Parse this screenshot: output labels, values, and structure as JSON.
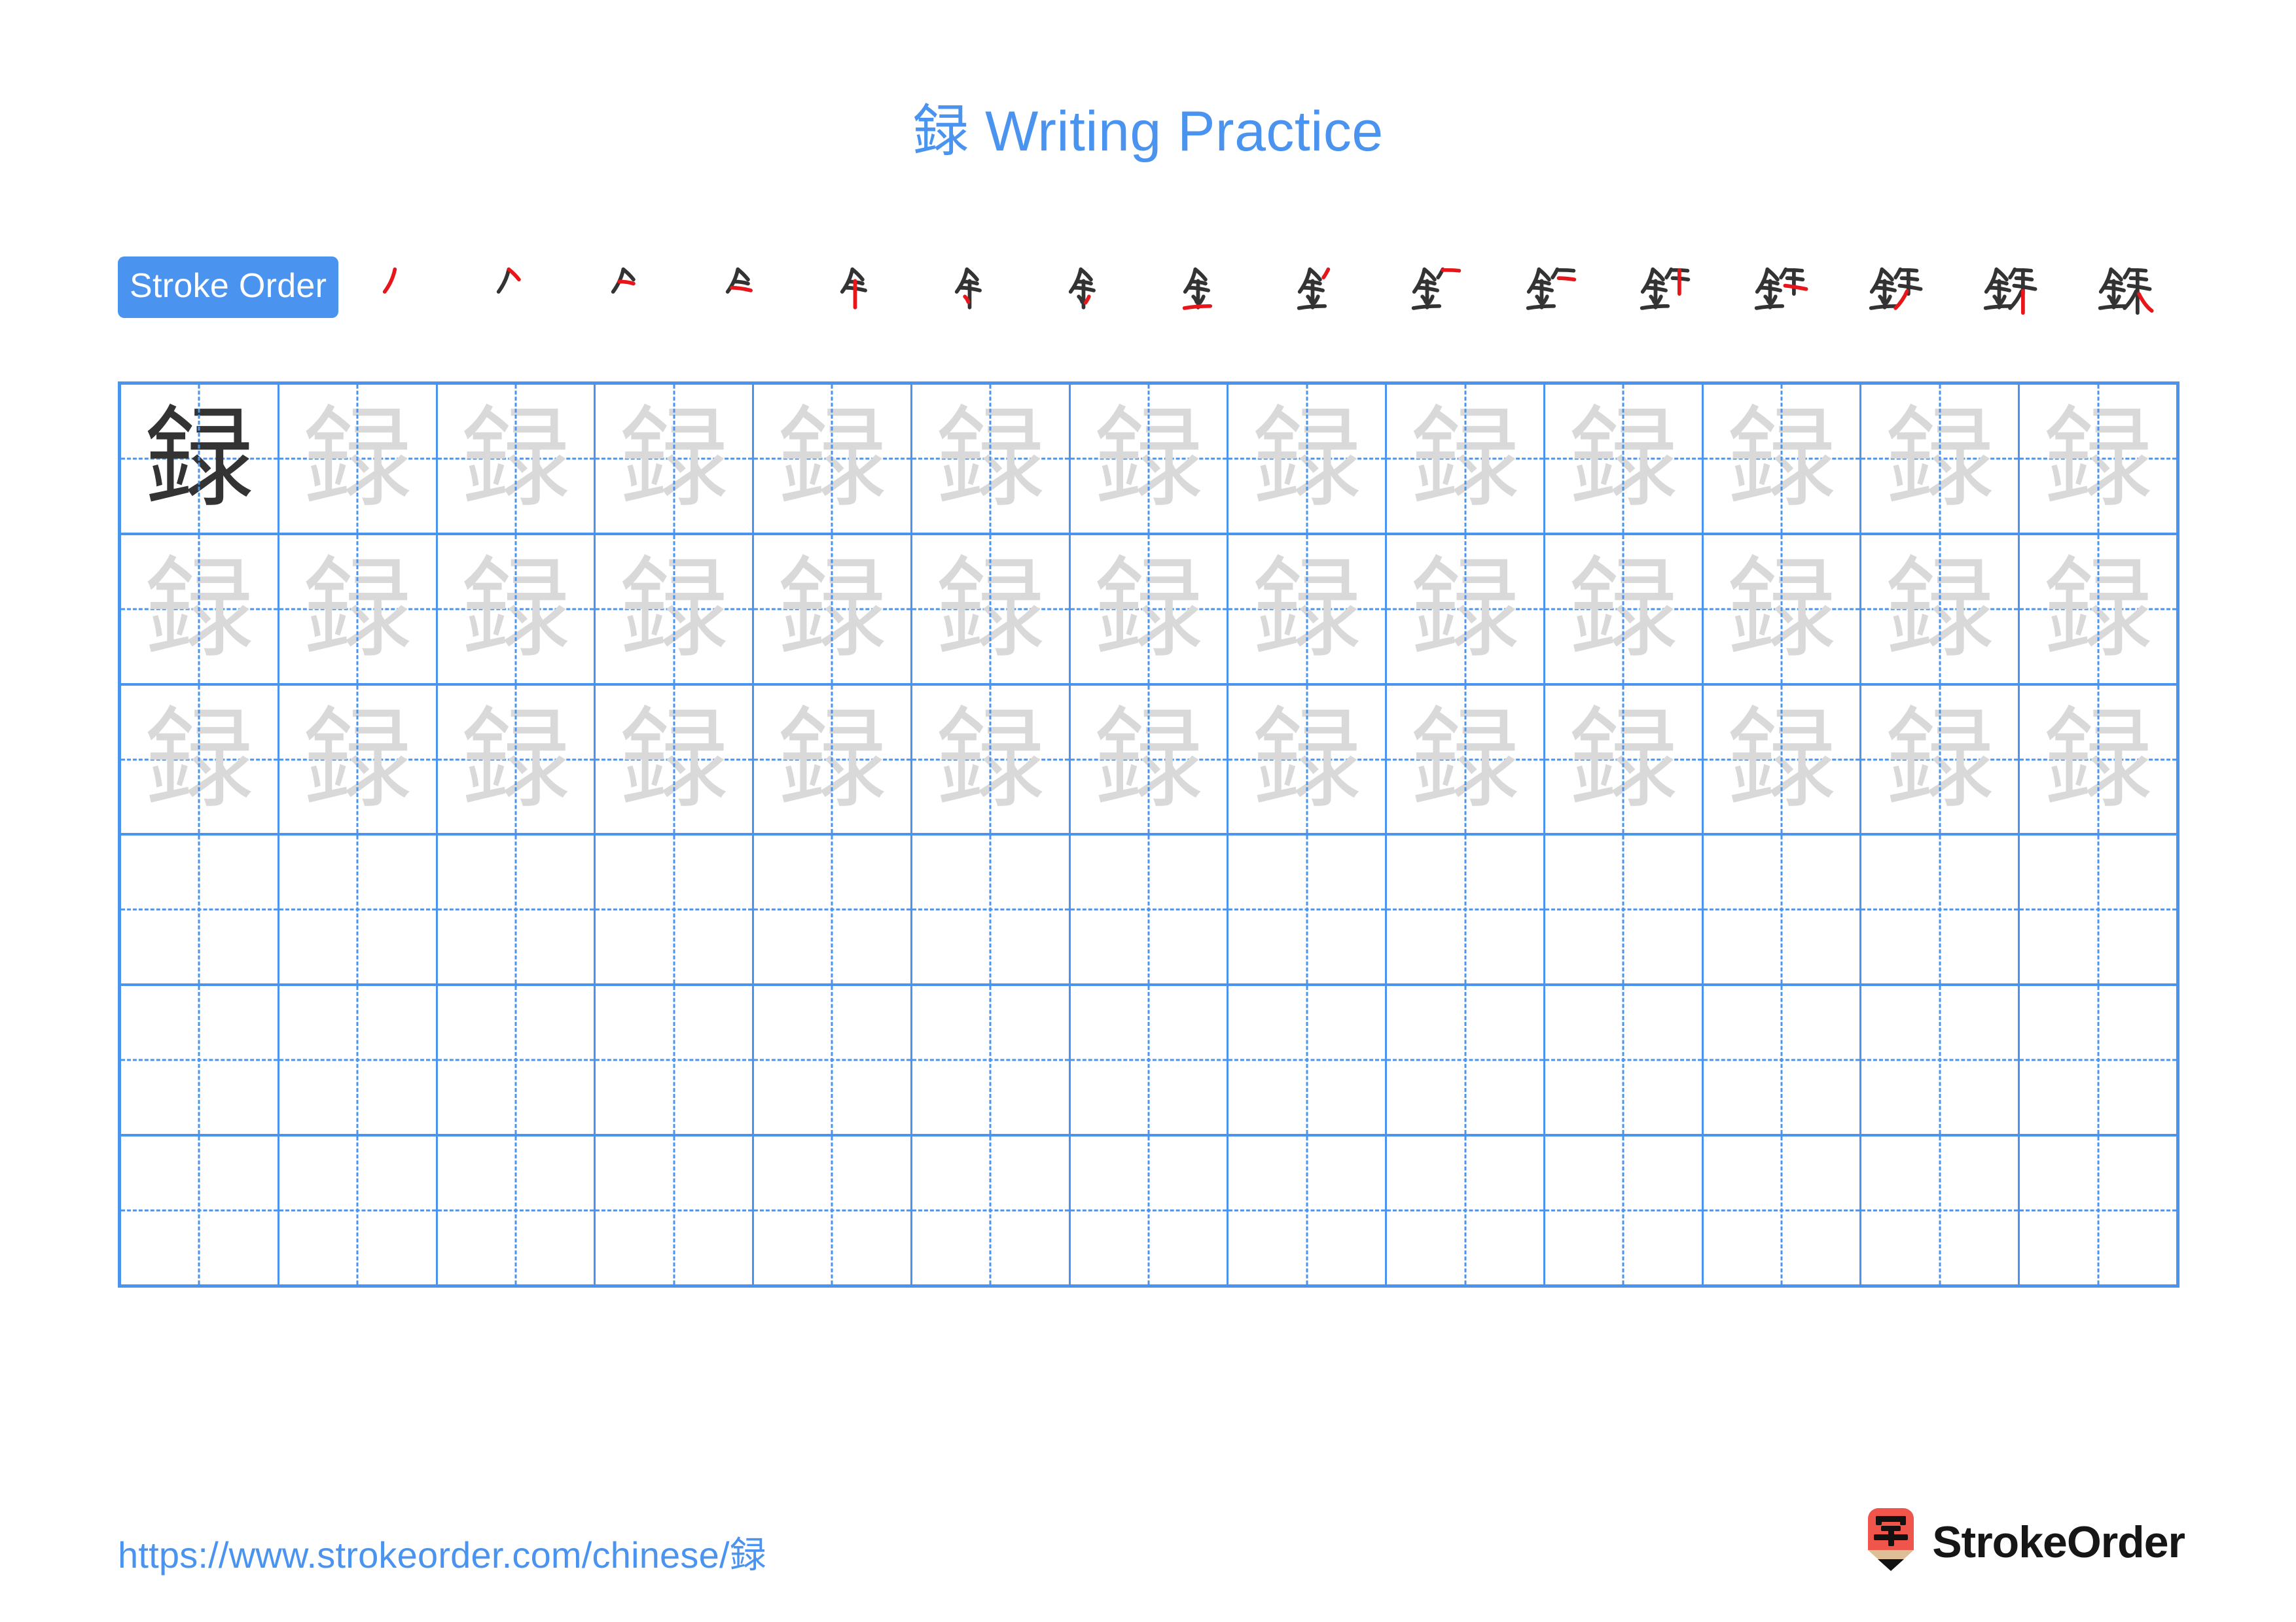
{
  "page": {
    "character": "録",
    "title": "録 Writing Practice",
    "accent_color": "#4a94f0",
    "trace_color": "#d9d9d9",
    "model_char_color": "#333333",
    "stroke_highlight_color": "#e8161a",
    "stroke_ink_color": "#333333"
  },
  "stroke_order": {
    "badge_label": "Stroke Order",
    "total_strokes": 16,
    "steps": [
      {
        "index": 1,
        "label": "stroke-step-1"
      },
      {
        "index": 2,
        "label": "stroke-step-2"
      },
      {
        "index": 3,
        "label": "stroke-step-3"
      },
      {
        "index": 4,
        "label": "stroke-step-4"
      },
      {
        "index": 5,
        "label": "stroke-step-5"
      },
      {
        "index": 6,
        "label": "stroke-step-6"
      },
      {
        "index": 7,
        "label": "stroke-step-7"
      },
      {
        "index": 8,
        "label": "stroke-step-8"
      },
      {
        "index": 9,
        "label": "stroke-step-9"
      },
      {
        "index": 10,
        "label": "stroke-step-10"
      },
      {
        "index": 11,
        "label": "stroke-step-11"
      },
      {
        "index": 12,
        "label": "stroke-step-12"
      },
      {
        "index": 13,
        "label": "stroke-step-13"
      },
      {
        "index": 14,
        "label": "stroke-step-14"
      },
      {
        "index": 15,
        "label": "stroke-step-15"
      },
      {
        "index": 16,
        "label": "stroke-step-16"
      }
    ]
  },
  "grid": {
    "columns": 13,
    "rows": 6,
    "cells": [
      [
        "model",
        "trace",
        "trace",
        "trace",
        "trace",
        "trace",
        "trace",
        "trace",
        "trace",
        "trace",
        "trace",
        "trace",
        "trace"
      ],
      [
        "trace",
        "trace",
        "trace",
        "trace",
        "trace",
        "trace",
        "trace",
        "trace",
        "trace",
        "trace",
        "trace",
        "trace",
        "trace"
      ],
      [
        "trace",
        "trace",
        "trace",
        "trace",
        "trace",
        "trace",
        "trace",
        "trace",
        "trace",
        "trace",
        "trace",
        "trace",
        "trace"
      ],
      [
        "empty",
        "empty",
        "empty",
        "empty",
        "empty",
        "empty",
        "empty",
        "empty",
        "empty",
        "empty",
        "empty",
        "empty",
        "empty"
      ],
      [
        "empty",
        "empty",
        "empty",
        "empty",
        "empty",
        "empty",
        "empty",
        "empty",
        "empty",
        "empty",
        "empty",
        "empty",
        "empty"
      ],
      [
        "empty",
        "empty",
        "empty",
        "empty",
        "empty",
        "empty",
        "empty",
        "empty",
        "empty",
        "empty",
        "empty",
        "empty",
        "empty"
      ]
    ]
  },
  "footer": {
    "url": "https://www.strokeorder.com/chinese/録",
    "brand_name": "StrokeOrder",
    "logo_char": "字",
    "logo_body_color": "#f0554c",
    "logo_wood_color": "#debe96",
    "logo_tip_color": "#121212"
  }
}
